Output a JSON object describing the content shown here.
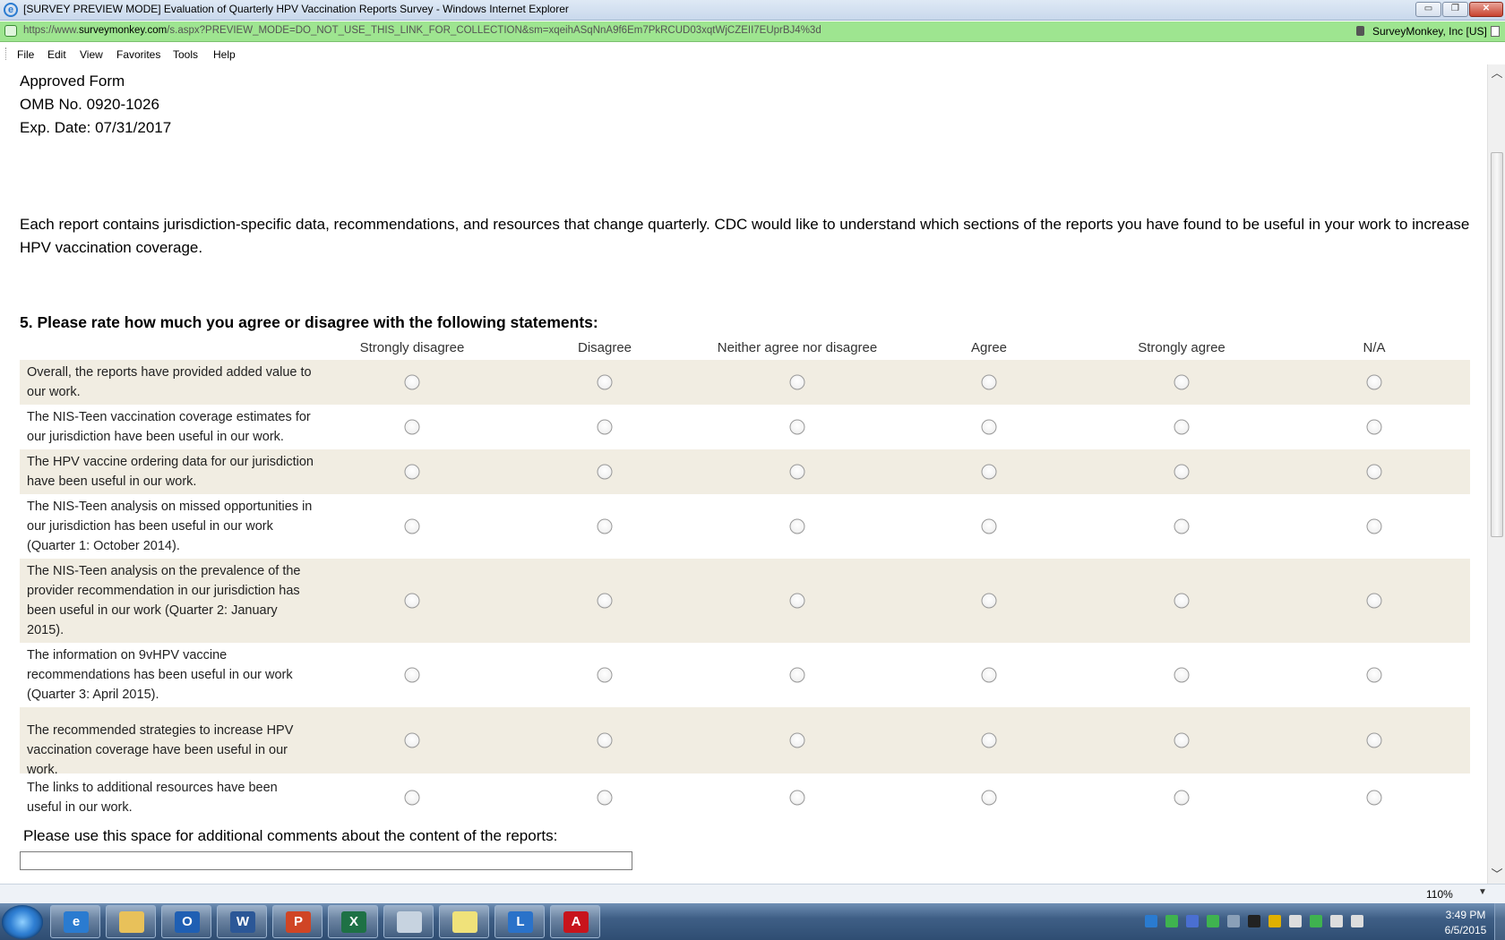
{
  "window": {
    "title": "[SURVEY PREVIEW MODE] Evaluation of Quarterly HPV Vaccination Reports Survey - Windows Internet Explorer",
    "min_glyph": "▭",
    "max_glyph": "❐",
    "close_glyph": "✕"
  },
  "address": {
    "url_prefix": "https://www.",
    "url_host": "surveymonkey.com",
    "url_path": "/s.aspx?PREVIEW_MODE=DO_NOT_USE_THIS_LINK_FOR_COLLECTION&sm=xqeihASqNnA9f6Em7PkRCUD03xqtWjCZEII7EUprBJ4%3d",
    "certificate": "SurveyMonkey, Inc [US]"
  },
  "menu": [
    "File",
    "Edit",
    "View",
    "Favorites",
    "Tools",
    "Help"
  ],
  "header": {
    "approved": "Approved Form",
    "omb": "OMB No. 0920-1026",
    "exp": "Exp. Date: 07/31/2017"
  },
  "intro": "Each report contains jurisdiction-specific data, recommendations, and resources that change quarterly. CDC would like to understand which sections of the reports you have found to be useful in your work to increase HPV vaccination coverage.",
  "question": {
    "title": "5. Please rate how much you agree or disagree with the following statements:",
    "columns": [
      "Strongly disagree",
      "Disagree",
      "Neither agree nor disagree",
      "Agree",
      "Strongly agree",
      "N/A"
    ],
    "rows": [
      "Overall, the reports have provided added value to our work.",
      "The NIS-Teen vaccination coverage estimates for our jurisdiction have been useful in our work.",
      "The HPV vaccine ordering data for our jurisdiction have been useful in our work.",
      "The NIS-Teen analysis on missed opportunities in our jurisdiction has been useful in our work (Quarter 1: October 2014).",
      "The NIS-Teen analysis on the prevalence of the provider recommendation in our jurisdiction has been useful in our work (Quarter 2: January 2015).",
      "The information on 9vHPV vaccine recommendations has been useful in our work (Quarter 3: April 2015).",
      "The recommended strategies to increase HPV vaccination coverage have been useful in our work.",
      "The links to additional resources have been useful in our work."
    ],
    "comments_label": "Please use this space for additional comments about the content of the reports:"
  },
  "statusbar": {
    "zoom": "110%",
    "zoom_arrow": "▼"
  },
  "scrollbar": {
    "up": "︿",
    "down": "﹀"
  },
  "taskbar": {
    "apps": [
      {
        "name": "internet-explorer",
        "glyph": "e",
        "color": "#2a7bd0"
      },
      {
        "name": "file-explorer",
        "glyph": "",
        "color": "#e8c15a"
      },
      {
        "name": "outlook",
        "glyph": "O",
        "color": "#1f5fb3"
      },
      {
        "name": "word",
        "glyph": "W",
        "color": "#2b5797"
      },
      {
        "name": "powerpoint",
        "glyph": "P",
        "color": "#d04525"
      },
      {
        "name": "excel",
        "glyph": "X",
        "color": "#1e7145"
      },
      {
        "name": "calculator",
        "glyph": "",
        "color": "#c7d3e0"
      },
      {
        "name": "sticky-notes",
        "glyph": "",
        "color": "#f0e27a"
      },
      {
        "name": "lync",
        "glyph": "L",
        "color": "#2a72c9"
      },
      {
        "name": "acrobat",
        "glyph": "A",
        "color": "#c8141c"
      }
    ],
    "tray_colors": [
      "#2a7bd0",
      "#3fb34f",
      "#4a6fd1",
      "#3fb34f",
      "#8aa0b8",
      "#222222",
      "#e0b000",
      "#dddddd",
      "#3fb34f",
      "#dddddd",
      "#dddddd"
    ],
    "time": "3:49 PM",
    "date": "6/5/2015"
  }
}
